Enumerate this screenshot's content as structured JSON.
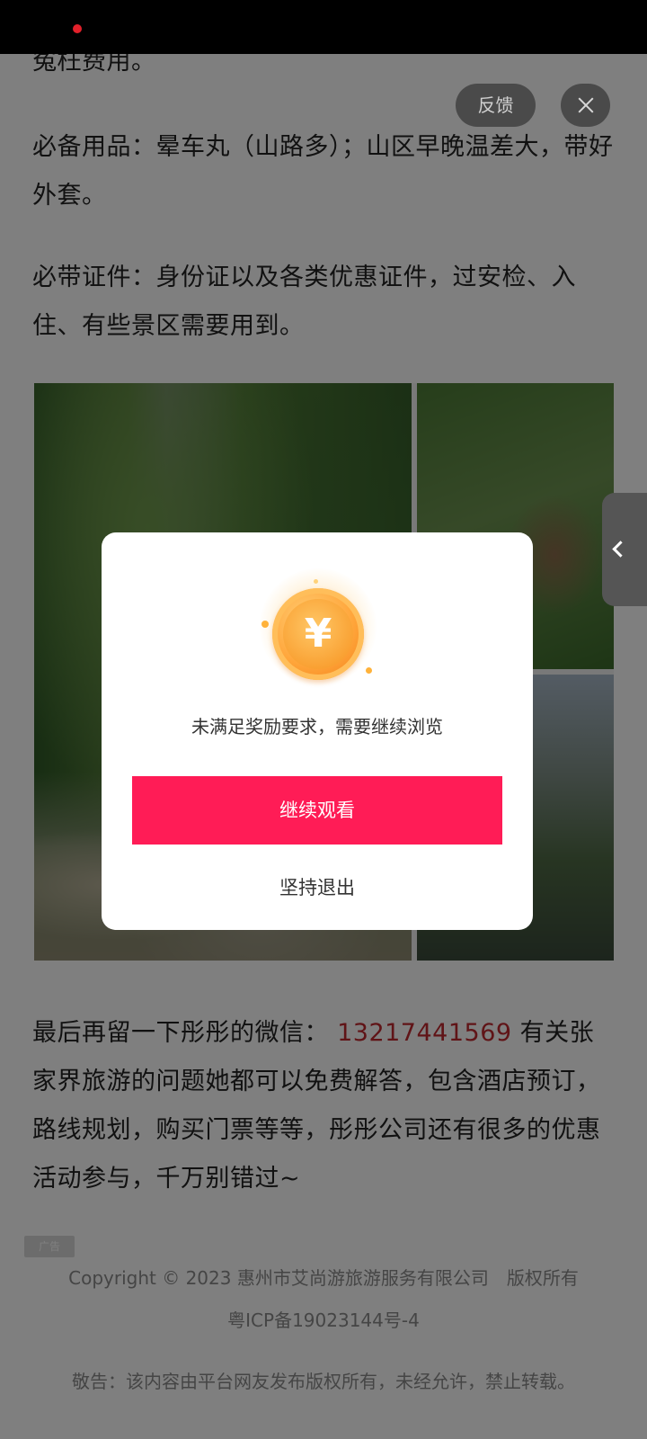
{
  "article": {
    "para0": "冤枉费用。",
    "para1": "必备用品：晕车丸（山路多）；山区早晚温差大，带好外套。",
    "para2": "必带证件：身份证以及各类优惠证件，过安检、入住、有些景区需要用到。",
    "para_last_prefix": "最后再留一下彤彤的微信：",
    "phone": "13217441569",
    "para_last_suffix": "有关张家界旅游的问题她都可以免费解答，包含酒店预订，路线规划，购买门票等等，彤彤公司还有很多的优惠活动参与，千万别错过~"
  },
  "ad_badge": "广告",
  "footer": {
    "copyright": "Copyright © 2023 惠州市艾尚游旅游服务有限公司　版权所有",
    "icp": "粤ICP备19023144号-4",
    "notice": "敬告：该内容由平台网友发布版权所有，未经允许，禁止转载。"
  },
  "top_controls": {
    "feedback_label": "反馈"
  },
  "modal": {
    "coin_symbol": "¥",
    "message": "未满足奖励要求，需要继续浏览",
    "continue_label": "继续观看",
    "exit_label": "坚持退出"
  },
  "colors": {
    "accent": "#ff1c56",
    "phone": "#c0282e"
  },
  "icons": [
    "close-icon",
    "chevron-left-icon",
    "coin-icon"
  ]
}
